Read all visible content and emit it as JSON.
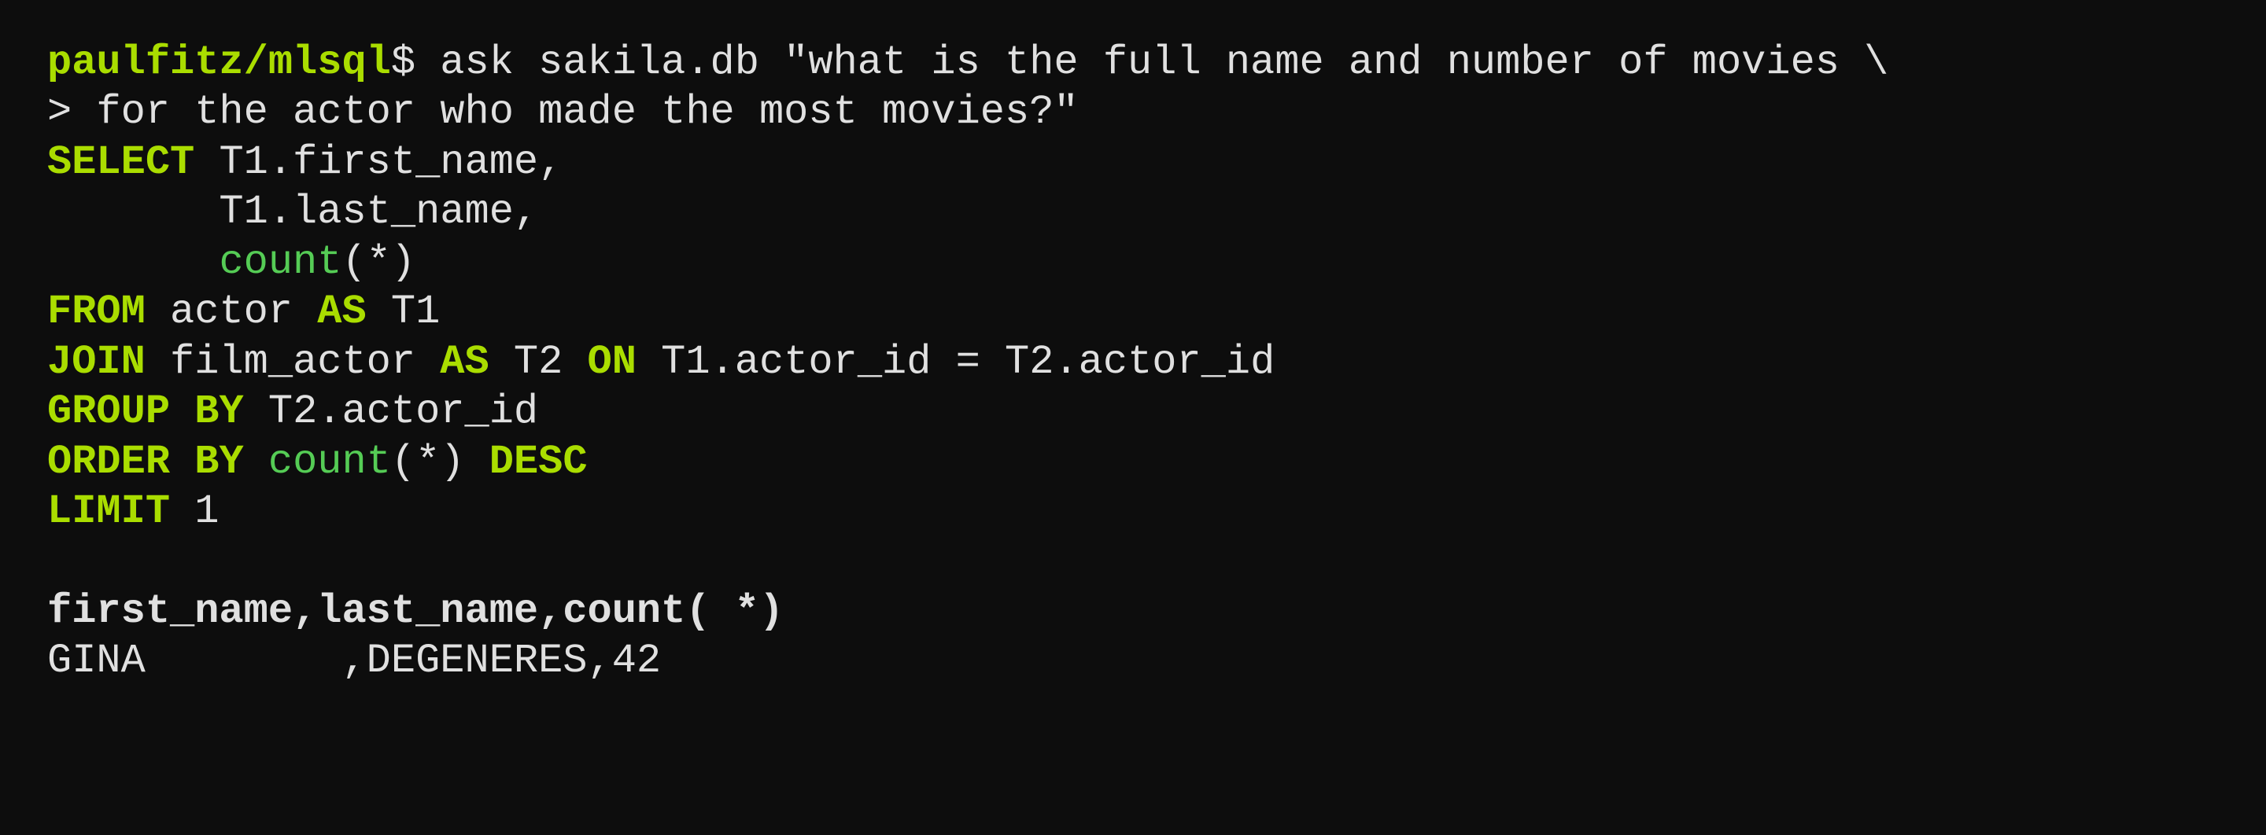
{
  "terminal": {
    "prompt_user": "paulfitz/mlsql",
    "prompt_dollar": "$",
    "lines": [
      {
        "id": "cmd-line1",
        "parts": [
          {
            "type": "prompt-user",
            "text": "paulfitz/mlsql"
          },
          {
            "type": "prompt-dollar",
            "text": "$ ask sakila.db \"what is the full name and number of movies \\"
          }
        ]
      },
      {
        "id": "cmd-line2",
        "parts": [
          {
            "type": "cmd-text",
            "text": "> for the actor who made the most movies?\""
          }
        ]
      },
      {
        "id": "sql-select",
        "parts": [
          {
            "type": "sql-keyword",
            "text": "SELECT"
          },
          {
            "type": "sql-plain",
            "text": " T1.first_name,"
          }
        ]
      },
      {
        "id": "sql-lastname",
        "parts": [
          {
            "type": "sql-plain",
            "text": "       T1.last_name,"
          }
        ]
      },
      {
        "id": "sql-count",
        "parts": [
          {
            "type": "sql-plain",
            "text": "       "
          },
          {
            "type": "sql-function",
            "text": "count"
          },
          {
            "type": "sql-plain",
            "text": "(*)"
          }
        ]
      },
      {
        "id": "sql-from",
        "parts": [
          {
            "type": "sql-keyword",
            "text": "FROM"
          },
          {
            "type": "sql-plain",
            "text": " actor "
          },
          {
            "type": "sql-keyword",
            "text": "AS"
          },
          {
            "type": "sql-plain",
            "text": " T1"
          }
        ]
      },
      {
        "id": "sql-join",
        "parts": [
          {
            "type": "sql-keyword",
            "text": "JOIN"
          },
          {
            "type": "sql-plain",
            "text": " film_actor "
          },
          {
            "type": "sql-keyword",
            "text": "AS"
          },
          {
            "type": "sql-plain",
            "text": " T2 "
          },
          {
            "type": "sql-keyword",
            "text": "ON"
          },
          {
            "type": "sql-plain",
            "text": " T1.actor_id = T2.actor_id"
          }
        ]
      },
      {
        "id": "sql-groupby",
        "parts": [
          {
            "type": "sql-keyword",
            "text": "GROUP"
          },
          {
            "type": "sql-plain",
            "text": " "
          },
          {
            "type": "sql-keyword",
            "text": "BY"
          },
          {
            "type": "sql-plain",
            "text": " T2.actor_id"
          }
        ]
      },
      {
        "id": "sql-orderby",
        "parts": [
          {
            "type": "sql-keyword",
            "text": "ORDER"
          },
          {
            "type": "sql-plain",
            "text": " "
          },
          {
            "type": "sql-keyword",
            "text": "BY"
          },
          {
            "type": "sql-plain",
            "text": " "
          },
          {
            "type": "sql-function",
            "text": "count"
          },
          {
            "type": "sql-plain",
            "text": "(*) "
          },
          {
            "type": "sql-keyword",
            "text": "DESC"
          }
        ]
      },
      {
        "id": "sql-limit",
        "parts": [
          {
            "type": "sql-keyword",
            "text": "LIMIT"
          },
          {
            "type": "sql-plain",
            "text": " 1"
          }
        ]
      },
      {
        "id": "empty",
        "parts": []
      },
      {
        "id": "result-header",
        "parts": [
          {
            "type": "result-header",
            "text": "first_name,last_name,count( *)"
          }
        ]
      },
      {
        "id": "result-data",
        "parts": [
          {
            "type": "result-data",
            "text": "GINA        ,DEGENERES,42"
          }
        ]
      }
    ]
  }
}
